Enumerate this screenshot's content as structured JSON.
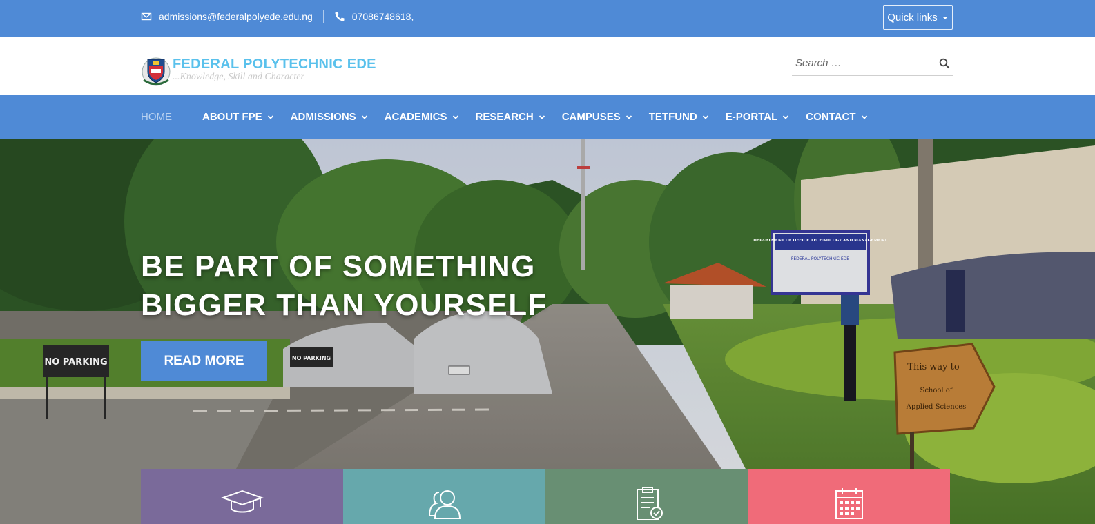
{
  "topbar": {
    "email": "admissions@federalpolyede.edu.ng",
    "phone": "07086748618,",
    "email_icon": "envelope-icon",
    "phone_icon": "phone-icon",
    "quick_links_label": "Quick links",
    "background": "#4f8ad6"
  },
  "header": {
    "logo_name": "FEDERAL POLYTECHNIC EDE",
    "logo_motto": "...Knowledge, Skill and Character",
    "search_placeholder": "Search …",
    "search_icon": "search-icon"
  },
  "nav": {
    "items": [
      {
        "label": "HOME",
        "active": true
      },
      {
        "label": "ABOUT FPE"
      },
      {
        "label": "ADMISSIONS"
      },
      {
        "label": "ACADEMICS"
      },
      {
        "label": "RESEARCH"
      },
      {
        "label": "CAMPUSES"
      },
      {
        "label": "TETFUND"
      },
      {
        "label": "E-PORTAL"
      },
      {
        "label": "CONTACT"
      }
    ]
  },
  "hero": {
    "headline_line1": "BE PART OF SOMETHING",
    "headline_line2": "BIGGER THAN YOURSELF",
    "button_label": "READ MORE",
    "signs": {
      "no_parking": "NO PARKING",
      "no_parking_small": "NO PARKING",
      "department_sign": "DEPARTMENT OF OFFICE TECHNOLOGY AND MANAGEMENT",
      "department_sign_sub": "FEDERAL POLYTECHNIC EDE",
      "direction_line1": "This way to",
      "direction_line2": "School of",
      "direction_line3": "Applied Sciences"
    }
  },
  "tiles": [
    {
      "icon": "graduation-cap-icon",
      "color": "#7a6a9a"
    },
    {
      "icon": "users-icon",
      "color": "#66a8ac"
    },
    {
      "icon": "clipboard-check-icon",
      "color": "#688f73"
    },
    {
      "icon": "calendar-icon",
      "color": "#f06b79"
    }
  ]
}
